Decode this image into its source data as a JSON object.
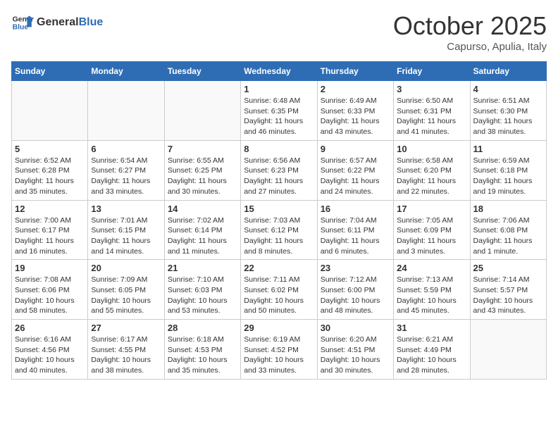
{
  "header": {
    "logo_general": "General",
    "logo_blue": "Blue",
    "month": "October 2025",
    "location": "Capurso, Apulia, Italy"
  },
  "weekdays": [
    "Sunday",
    "Monday",
    "Tuesday",
    "Wednesday",
    "Thursday",
    "Friday",
    "Saturday"
  ],
  "weeks": [
    [
      {
        "day": "",
        "info": ""
      },
      {
        "day": "",
        "info": ""
      },
      {
        "day": "",
        "info": ""
      },
      {
        "day": "1",
        "info": "Sunrise: 6:48 AM\nSunset: 6:35 PM\nDaylight: 11 hours and 46 minutes."
      },
      {
        "day": "2",
        "info": "Sunrise: 6:49 AM\nSunset: 6:33 PM\nDaylight: 11 hours and 43 minutes."
      },
      {
        "day": "3",
        "info": "Sunrise: 6:50 AM\nSunset: 6:31 PM\nDaylight: 11 hours and 41 minutes."
      },
      {
        "day": "4",
        "info": "Sunrise: 6:51 AM\nSunset: 6:30 PM\nDaylight: 11 hours and 38 minutes."
      }
    ],
    [
      {
        "day": "5",
        "info": "Sunrise: 6:52 AM\nSunset: 6:28 PM\nDaylight: 11 hours and 35 minutes."
      },
      {
        "day": "6",
        "info": "Sunrise: 6:54 AM\nSunset: 6:27 PM\nDaylight: 11 hours and 33 minutes."
      },
      {
        "day": "7",
        "info": "Sunrise: 6:55 AM\nSunset: 6:25 PM\nDaylight: 11 hours and 30 minutes."
      },
      {
        "day": "8",
        "info": "Sunrise: 6:56 AM\nSunset: 6:23 PM\nDaylight: 11 hours and 27 minutes."
      },
      {
        "day": "9",
        "info": "Sunrise: 6:57 AM\nSunset: 6:22 PM\nDaylight: 11 hours and 24 minutes."
      },
      {
        "day": "10",
        "info": "Sunrise: 6:58 AM\nSunset: 6:20 PM\nDaylight: 11 hours and 22 minutes."
      },
      {
        "day": "11",
        "info": "Sunrise: 6:59 AM\nSunset: 6:18 PM\nDaylight: 11 hours and 19 minutes."
      }
    ],
    [
      {
        "day": "12",
        "info": "Sunrise: 7:00 AM\nSunset: 6:17 PM\nDaylight: 11 hours and 16 minutes."
      },
      {
        "day": "13",
        "info": "Sunrise: 7:01 AM\nSunset: 6:15 PM\nDaylight: 11 hours and 14 minutes."
      },
      {
        "day": "14",
        "info": "Sunrise: 7:02 AM\nSunset: 6:14 PM\nDaylight: 11 hours and 11 minutes."
      },
      {
        "day": "15",
        "info": "Sunrise: 7:03 AM\nSunset: 6:12 PM\nDaylight: 11 hours and 8 minutes."
      },
      {
        "day": "16",
        "info": "Sunrise: 7:04 AM\nSunset: 6:11 PM\nDaylight: 11 hours and 6 minutes."
      },
      {
        "day": "17",
        "info": "Sunrise: 7:05 AM\nSunset: 6:09 PM\nDaylight: 11 hours and 3 minutes."
      },
      {
        "day": "18",
        "info": "Sunrise: 7:06 AM\nSunset: 6:08 PM\nDaylight: 11 hours and 1 minute."
      }
    ],
    [
      {
        "day": "19",
        "info": "Sunrise: 7:08 AM\nSunset: 6:06 PM\nDaylight: 10 hours and 58 minutes."
      },
      {
        "day": "20",
        "info": "Sunrise: 7:09 AM\nSunset: 6:05 PM\nDaylight: 10 hours and 55 minutes."
      },
      {
        "day": "21",
        "info": "Sunrise: 7:10 AM\nSunset: 6:03 PM\nDaylight: 10 hours and 53 minutes."
      },
      {
        "day": "22",
        "info": "Sunrise: 7:11 AM\nSunset: 6:02 PM\nDaylight: 10 hours and 50 minutes."
      },
      {
        "day": "23",
        "info": "Sunrise: 7:12 AM\nSunset: 6:00 PM\nDaylight: 10 hours and 48 minutes."
      },
      {
        "day": "24",
        "info": "Sunrise: 7:13 AM\nSunset: 5:59 PM\nDaylight: 10 hours and 45 minutes."
      },
      {
        "day": "25",
        "info": "Sunrise: 7:14 AM\nSunset: 5:57 PM\nDaylight: 10 hours and 43 minutes."
      }
    ],
    [
      {
        "day": "26",
        "info": "Sunrise: 6:16 AM\nSunset: 4:56 PM\nDaylight: 10 hours and 40 minutes."
      },
      {
        "day": "27",
        "info": "Sunrise: 6:17 AM\nSunset: 4:55 PM\nDaylight: 10 hours and 38 minutes."
      },
      {
        "day": "28",
        "info": "Sunrise: 6:18 AM\nSunset: 4:53 PM\nDaylight: 10 hours and 35 minutes."
      },
      {
        "day": "29",
        "info": "Sunrise: 6:19 AM\nSunset: 4:52 PM\nDaylight: 10 hours and 33 minutes."
      },
      {
        "day": "30",
        "info": "Sunrise: 6:20 AM\nSunset: 4:51 PM\nDaylight: 10 hours and 30 minutes."
      },
      {
        "day": "31",
        "info": "Sunrise: 6:21 AM\nSunset: 4:49 PM\nDaylight: 10 hours and 28 minutes."
      },
      {
        "day": "",
        "info": ""
      }
    ]
  ]
}
